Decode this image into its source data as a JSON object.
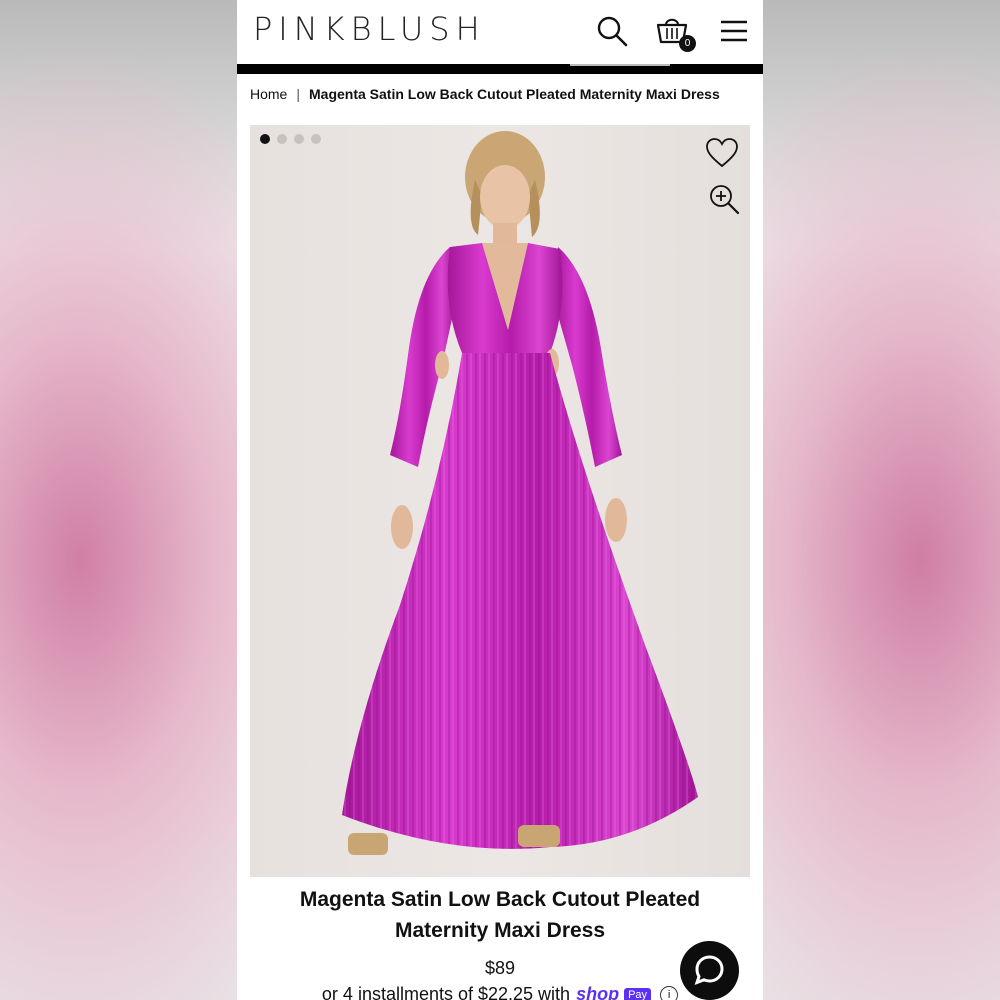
{
  "header": {
    "logo": "PINKBLUSH",
    "bag_count": "0",
    "icons": [
      "search-icon",
      "shopping-bag-icon",
      "hamburger-menu-icon"
    ]
  },
  "breadcrumb": {
    "home": "Home",
    "separator": "|",
    "current": "Magenta Satin Low Back Cutout Pleated Maternity Maxi Dress"
  },
  "gallery": {
    "image_count": 4,
    "active_index": 0,
    "icons": [
      "heart-icon",
      "zoom-in-icon"
    ]
  },
  "product": {
    "title_line1": "Magenta Satin Low Back Cutout Pleated",
    "title_line2": "Maternity Maxi Dress",
    "price": "$89",
    "installments_text": "or 4 installments of $22.25 with",
    "shop_label": "shop",
    "pay_label": "Pay",
    "info_symbol": "i"
  },
  "colors": {
    "dress": "#c624b8",
    "accent_shop_pay": "#5a31f4",
    "text": "#111111"
  },
  "chat": {
    "icon": "chat-bubble-icon"
  }
}
